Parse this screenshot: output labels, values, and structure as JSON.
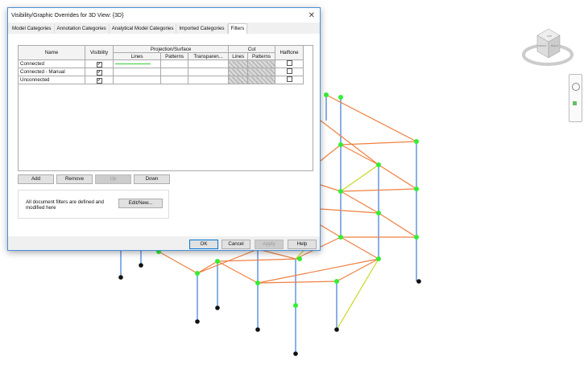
{
  "dialog": {
    "title": "Visibility/Graphic Overrides for 3D View: {3D}",
    "tabs": [
      "Model Categories",
      "Annotation Categories",
      "Analytical Model Categories",
      "Imported Categories",
      "Filters"
    ],
    "active_tab": "Filters",
    "headers": {
      "name": "Name",
      "visibility": "Visibility",
      "projection": "Projection/Surface",
      "cut": "Cut",
      "halftone": "Halftone",
      "lines": "Lines",
      "patterns": "Patterns",
      "transparency": "Transparen...",
      "cut_lines": "Lines",
      "cut_patterns": "Patterns"
    },
    "rows": [
      {
        "name": "Connected",
        "visible": true,
        "line_color": "#33cc33",
        "halftone": false
      },
      {
        "name": "Connected - Manual",
        "visible": true,
        "halftone": false
      },
      {
        "name": "Unconnected",
        "visible": true,
        "halftone": false
      }
    ],
    "buttons": {
      "add": "Add",
      "remove": "Remove",
      "up": "Up",
      "down": "Down",
      "edit": "Edit/New...",
      "ok": "OK",
      "cancel": "Cancel",
      "apply": "Apply",
      "help": "Help"
    },
    "info_text": "All document filters are defined and modified here",
    "close": "✕"
  },
  "viewcube": {
    "top": "TOP",
    "front": "FRONT",
    "right": "RIGHT"
  },
  "colors": {
    "column": "#3a7bd5",
    "beam": "#f08040",
    "brace": "#c8d820",
    "node": "#33ee33",
    "support": "#111111"
  }
}
